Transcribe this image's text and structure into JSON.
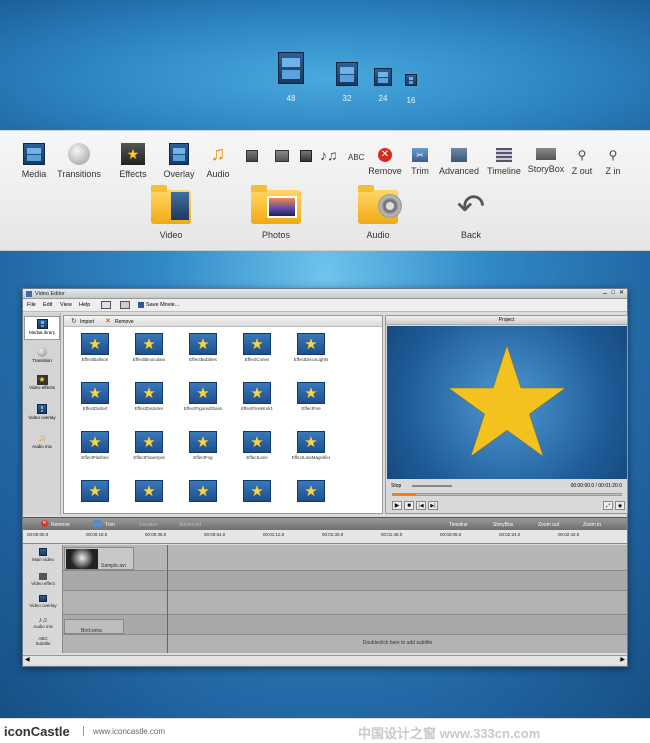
{
  "sizes": [
    "48",
    "32",
    "24",
    "16"
  ],
  "toolbar": {
    "items": [
      {
        "label": "Media",
        "icon": "film-icon"
      },
      {
        "label": "Transitions",
        "icon": "transition-icon"
      },
      {
        "label": "Effects",
        "icon": "effects-icon"
      },
      {
        "label": "Overlay",
        "icon": "overlay-icon"
      },
      {
        "label": "Audio",
        "icon": "music-note-icon"
      }
    ],
    "small_icons": [
      "film-frame-icon",
      "film-stack-icon",
      "film-strip-icon",
      "music-notes-icon"
    ],
    "abc": "ABC",
    "right_items": [
      {
        "label": "Remove",
        "icon": "remove-icon"
      },
      {
        "label": "Trim",
        "icon": "trim-icon"
      },
      {
        "label": "Advanced",
        "icon": "advanced-icon"
      },
      {
        "label": "Timeline",
        "icon": "timeline-icon"
      },
      {
        "label": "StoryBox",
        "icon": "storybox-icon"
      },
      {
        "label": "Z out",
        "icon": "zoom-out-icon"
      },
      {
        "label": "Z in",
        "icon": "zoom-in-icon"
      }
    ],
    "big_items": [
      {
        "label": "Video",
        "icon": "video-folder-icon"
      },
      {
        "label": "Photos",
        "icon": "photos-folder-icon"
      },
      {
        "label": "Audio",
        "icon": "audio-folder-icon"
      },
      {
        "label": "Back",
        "icon": "back-arrow-icon"
      }
    ]
  },
  "editor": {
    "title": "Video Editor",
    "menu": [
      "File",
      "Edit",
      "View",
      "Help"
    ],
    "save_movie": "Save Movie...",
    "side": [
      {
        "label": "MediaLibrary",
        "icon": "film-icon"
      },
      {
        "label": "Transition",
        "icon": "transition-icon"
      },
      {
        "label": "Video effects",
        "icon": "effects-icon"
      },
      {
        "label": "Video overlay",
        "icon": "overlay-icon"
      },
      {
        "label": "Audio mix",
        "icon": "music-note-icon"
      }
    ],
    "library_toolbar": {
      "import": "Import",
      "remove": "Remove"
    },
    "effects": [
      "EffectBalloon",
      "EffectBinoculars",
      "EffectBubbles",
      "EffectCones",
      "EffectDiscoLights",
      "EffectDistort",
      "EffectDistorter",
      "EffectFiguredGlass",
      "EffectFireWork1",
      "EffectFire",
      "EffectFlashes",
      "EffectFlowerpot",
      "EffectFog",
      "EffectLens",
      "EffectLineMagnifier",
      "",
      "",
      "",
      "",
      ""
    ],
    "project_label": "Project",
    "player": {
      "status": "Stop",
      "time": "00:00:00.0 / 00:01:20.0",
      "progress": 0.1
    },
    "timeline_toolbar": {
      "remove": "Remove",
      "trim": "Trim",
      "duration": "Duration",
      "advanced": "Advanced",
      "timeline": "Timeline",
      "storybox": "StoryBox",
      "zoom_out": "Zoom out",
      "zoom_in": "Zoom in"
    },
    "ruler": [
      "00:00:00.0",
      "00:00:18.0",
      "00:00:36.0",
      "00:00:54.0",
      "00:01:12.0",
      "00:01:30.0",
      "00:01:48.0",
      "00:02:06.0",
      "00:02:24.0",
      "00:02:42.0"
    ],
    "tracks": [
      {
        "label": "Main video",
        "icon": "film-icon"
      },
      {
        "label": "Video effect",
        "icon": "effects-icon"
      },
      {
        "label": "Video overlay",
        "icon": "overlay-icon"
      },
      {
        "label": "Audio mix",
        "icon": "music-notes-icon"
      },
      {
        "label": "Subtitle",
        "icon": "abc-icon",
        "abc": "ABC"
      }
    ],
    "clips": {
      "video": "Sample.avi",
      "audio": "Bird.wma"
    },
    "subtitle_hint": "Doubleclick here to add subtitle"
  },
  "footer": {
    "brand": "iconCastle",
    "url": "www.iconcastle.com",
    "watermark": "中国设计之窗 www.333cn.com"
  }
}
